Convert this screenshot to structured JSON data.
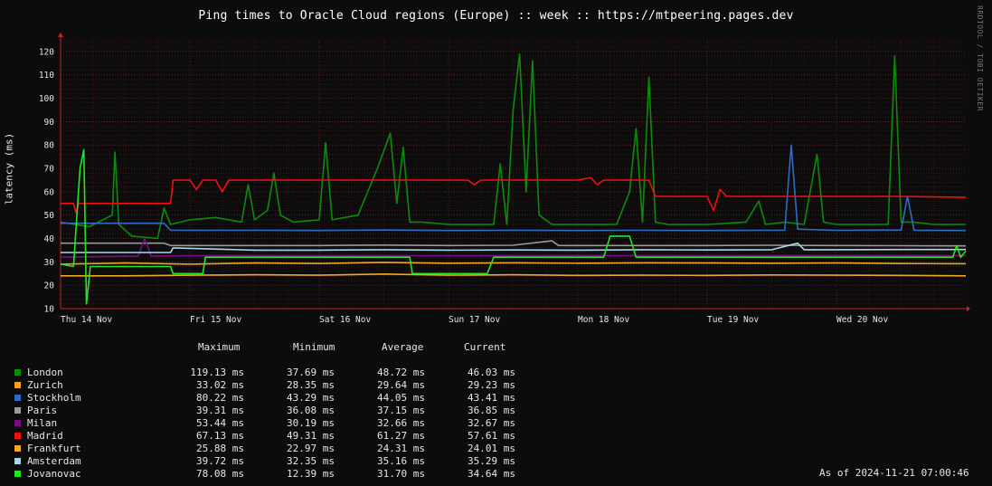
{
  "title": "Ping times to Oracle Cloud regions (Europe) :: week :: https://mtpeering.pages.dev",
  "watermark": "RRDTOOL / TOBI OETIKER",
  "legend_headers": {
    "maximum": "Maximum",
    "minimum": "Minimum",
    "average": "Average",
    "current": "Current"
  },
  "legend_rows": [
    {
      "name": "London",
      "color": "#0b8c0b",
      "max": "119.13 ms",
      "min": "37.69 ms",
      "avg": "48.72 ms",
      "cur": "46.03 ms"
    },
    {
      "name": "Zurich",
      "color": "#f0a21c",
      "max": "33.02 ms",
      "min": "28.35 ms",
      "avg": "29.64 ms",
      "cur": "29.23 ms"
    },
    {
      "name": "Stockholm",
      "color": "#2f6cc2",
      "max": "80.22 ms",
      "min": "43.29 ms",
      "avg": "44.05 ms",
      "cur": "43.41 ms"
    },
    {
      "name": "Paris",
      "color": "#9a9a9a",
      "max": "39.31 ms",
      "min": "36.08 ms",
      "avg": "37.15 ms",
      "cur": "36.85 ms"
    },
    {
      "name": "Milan",
      "color": "#7a0d86",
      "max": "53.44 ms",
      "min": "30.19 ms",
      "avg": "32.66 ms",
      "cur": "32.67 ms"
    },
    {
      "name": "Madrid",
      "color": "#f01010",
      "max": "67.13 ms",
      "min": "49.31 ms",
      "avg": "61.27 ms",
      "cur": "57.61 ms"
    },
    {
      "name": "Frankfurt",
      "color": "#f5a623",
      "max": "25.88 ms",
      "min": "22.97 ms",
      "avg": "24.31 ms",
      "cur": "24.01 ms"
    },
    {
      "name": "Amsterdam",
      "color": "#a9d8ea",
      "max": "39.72 ms",
      "min": "32.35 ms",
      "avg": "35.16 ms",
      "cur": "35.29 ms"
    },
    {
      "name": "Jovanovac",
      "color": "#22e622",
      "max": "78.08 ms",
      "min": "12.39 ms",
      "avg": "31.70 ms",
      "cur": "34.64 ms"
    }
  ],
  "as_of": "As of 2024-11-21 07:00:46",
  "chart_data": {
    "type": "line",
    "title": "Ping times to Oracle Cloud regions (Europe) :: week :: https://mtpeering.pages.dev",
    "ylabel": "latency (ms)",
    "xlabel": "",
    "ylim": [
      10,
      125
    ],
    "yticks": [
      10,
      20,
      30,
      40,
      50,
      60,
      70,
      80,
      90,
      100,
      110,
      120
    ],
    "xlim": [
      0,
      7
    ],
    "xtick_labels": [
      "Thu 14 Nov",
      "Fri 15 Nov",
      "Sat 16 Nov",
      "Sun 17 Nov",
      "Mon 18 Nov",
      "Tue 19 Nov",
      "Wed 20 Nov"
    ],
    "grid": true,
    "series": [
      {
        "name": "London",
        "color": "#0b8c0b",
        "points": [
          [
            0,
            47
          ],
          [
            0.22,
            45
          ],
          [
            0.4,
            50
          ],
          [
            0.42,
            77
          ],
          [
            0.45,
            46
          ],
          [
            0.55,
            41
          ],
          [
            0.75,
            40
          ],
          [
            0.8,
            53
          ],
          [
            0.85,
            46
          ],
          [
            1.0,
            48
          ],
          [
            1.2,
            49
          ],
          [
            1.4,
            47
          ],
          [
            1.45,
            63
          ],
          [
            1.5,
            48
          ],
          [
            1.6,
            52
          ],
          [
            1.65,
            68
          ],
          [
            1.7,
            50
          ],
          [
            1.8,
            47
          ],
          [
            2.0,
            48
          ],
          [
            2.05,
            81
          ],
          [
            2.1,
            48
          ],
          [
            2.3,
            50
          ],
          [
            2.45,
            70
          ],
          [
            2.55,
            85
          ],
          [
            2.6,
            55
          ],
          [
            2.65,
            79
          ],
          [
            2.7,
            47
          ],
          [
            2.8,
            47
          ],
          [
            3.0,
            46
          ],
          [
            3.35,
            46
          ],
          [
            3.4,
            72
          ],
          [
            3.45,
            46
          ],
          [
            3.5,
            95
          ],
          [
            3.55,
            119
          ],
          [
            3.6,
            60
          ],
          [
            3.65,
            116
          ],
          [
            3.7,
            50
          ],
          [
            3.8,
            46
          ],
          [
            4.0,
            46
          ],
          [
            4.3,
            46
          ],
          [
            4.4,
            60
          ],
          [
            4.45,
            87
          ],
          [
            4.5,
            47
          ],
          [
            4.55,
            109
          ],
          [
            4.6,
            47
          ],
          [
            4.7,
            46
          ],
          [
            5.0,
            46
          ],
          [
            5.3,
            47
          ],
          [
            5.4,
            56
          ],
          [
            5.45,
            46
          ],
          [
            5.6,
            47
          ],
          [
            5.75,
            46
          ],
          [
            5.85,
            76
          ],
          [
            5.9,
            47
          ],
          [
            6.0,
            46
          ],
          [
            6.4,
            46
          ],
          [
            6.45,
            118
          ],
          [
            6.5,
            47
          ],
          [
            6.6,
            47
          ],
          [
            6.75,
            46
          ],
          [
            7.0,
            46
          ]
        ]
      },
      {
        "name": "Zurich",
        "color": "#f0a21c",
        "points": [
          [
            0,
            29
          ],
          [
            0.5,
            29.5
          ],
          [
            1.0,
            29
          ],
          [
            1.5,
            29.5
          ],
          [
            2.0,
            29.3
          ],
          [
            2.5,
            29.8
          ],
          [
            3.0,
            29.4
          ],
          [
            3.5,
            29.6
          ],
          [
            4.0,
            29.4
          ],
          [
            4.5,
            29.6
          ],
          [
            5.0,
            29.5
          ],
          [
            5.5,
            29.4
          ],
          [
            6.0,
            29.5
          ],
          [
            6.5,
            29.3
          ],
          [
            7.0,
            29.2
          ]
        ]
      },
      {
        "name": "Stockholm",
        "color": "#2f6cc2",
        "points": [
          [
            0,
            46.5
          ],
          [
            0.8,
            46.5
          ],
          [
            0.85,
            43.5
          ],
          [
            1.5,
            43.5
          ],
          [
            2.0,
            43.4
          ],
          [
            2.5,
            43.6
          ],
          [
            3.0,
            43.4
          ],
          [
            3.5,
            43.5
          ],
          [
            4.0,
            43.4
          ],
          [
            4.5,
            43.5
          ],
          [
            5.0,
            43.4
          ],
          [
            5.5,
            43.5
          ],
          [
            5.6,
            43.5
          ],
          [
            5.65,
            80
          ],
          [
            5.7,
            44
          ],
          [
            6.0,
            43.5
          ],
          [
            6.5,
            43.6
          ],
          [
            6.55,
            58
          ],
          [
            6.6,
            43.5
          ],
          [
            7.0,
            43.4
          ]
        ]
      },
      {
        "name": "Paris",
        "color": "#9a9a9a",
        "points": [
          [
            0,
            38
          ],
          [
            0.8,
            38
          ],
          [
            0.85,
            37
          ],
          [
            1.5,
            37
          ],
          [
            2.0,
            37
          ],
          [
            2.5,
            37.2
          ],
          [
            3.0,
            37
          ],
          [
            3.5,
            37.1
          ],
          [
            3.8,
            39
          ],
          [
            3.85,
            37
          ],
          [
            4.5,
            37
          ],
          [
            5.0,
            37
          ],
          [
            5.5,
            37.1
          ],
          [
            6.0,
            37
          ],
          [
            6.5,
            36.9
          ],
          [
            7.0,
            36.85
          ]
        ]
      },
      {
        "name": "Milan",
        "color": "#7a0d86",
        "points": [
          [
            0,
            32
          ],
          [
            0.6,
            32.5
          ],
          [
            0.65,
            40
          ],
          [
            0.7,
            32.5
          ],
          [
            1.0,
            32.6
          ],
          [
            1.5,
            32.7
          ],
          [
            2.0,
            32.6
          ],
          [
            3.0,
            32.6
          ],
          [
            4.0,
            32.7
          ],
          [
            5.0,
            32.6
          ],
          [
            6.0,
            32.7
          ],
          [
            7.0,
            32.67
          ]
        ]
      },
      {
        "name": "Madrid",
        "color": "#f01010",
        "points": [
          [
            0,
            55
          ],
          [
            0.1,
            55
          ],
          [
            0.12,
            51
          ],
          [
            0.14,
            55
          ],
          [
            0.85,
            55
          ],
          [
            0.87,
            65
          ],
          [
            1.0,
            65
          ],
          [
            1.05,
            61
          ],
          [
            1.1,
            65
          ],
          [
            1.2,
            65
          ],
          [
            1.25,
            60
          ],
          [
            1.3,
            65
          ],
          [
            2.0,
            65
          ],
          [
            3.0,
            65
          ],
          [
            3.15,
            65
          ],
          [
            3.2,
            63
          ],
          [
            3.25,
            65
          ],
          [
            4.0,
            65
          ],
          [
            4.1,
            66
          ],
          [
            4.15,
            63
          ],
          [
            4.2,
            65
          ],
          [
            4.45,
            65
          ],
          [
            4.55,
            65
          ],
          [
            4.6,
            58
          ],
          [
            5.0,
            58
          ],
          [
            5.05,
            52
          ],
          [
            5.1,
            61
          ],
          [
            5.15,
            58
          ],
          [
            5.5,
            58
          ],
          [
            6.0,
            58
          ],
          [
            6.5,
            58
          ],
          [
            7.0,
            57.6
          ]
        ]
      },
      {
        "name": "Frankfurt",
        "color": "#f5a623",
        "points": [
          [
            0,
            24
          ],
          [
            0.5,
            24
          ],
          [
            1.0,
            24.3
          ],
          [
            1.5,
            24.5
          ],
          [
            2.0,
            24.3
          ],
          [
            2.5,
            24.8
          ],
          [
            3.0,
            24.3
          ],
          [
            3.5,
            24.5
          ],
          [
            4.0,
            24.2
          ],
          [
            4.5,
            24.3
          ],
          [
            5.0,
            24.2
          ],
          [
            5.5,
            24.4
          ],
          [
            6.0,
            24.3
          ],
          [
            6.5,
            24.2
          ],
          [
            7.0,
            24.0
          ]
        ]
      },
      {
        "name": "Amsterdam",
        "color": "#a9d8ea",
        "points": [
          [
            0,
            34
          ],
          [
            0.85,
            34
          ],
          [
            0.87,
            36
          ],
          [
            1.5,
            35
          ],
          [
            2.0,
            35
          ],
          [
            2.5,
            35.2
          ],
          [
            3.0,
            35
          ],
          [
            3.5,
            35.1
          ],
          [
            4.0,
            35
          ],
          [
            4.5,
            35.2
          ],
          [
            5.0,
            35.1
          ],
          [
            5.5,
            35.2
          ],
          [
            5.7,
            38
          ],
          [
            5.75,
            35.2
          ],
          [
            6.0,
            35.2
          ],
          [
            6.5,
            35.3
          ],
          [
            7.0,
            35.29
          ]
        ]
      },
      {
        "name": "Jovanovac",
        "color": "#22e622",
        "points": [
          [
            0,
            29
          ],
          [
            0.1,
            28
          ],
          [
            0.15,
            70
          ],
          [
            0.18,
            78
          ],
          [
            0.2,
            12
          ],
          [
            0.23,
            28
          ],
          [
            0.85,
            28
          ],
          [
            0.87,
            25
          ],
          [
            1.1,
            25
          ],
          [
            1.12,
            32
          ],
          [
            2.0,
            32
          ],
          [
            2.5,
            32
          ],
          [
            2.7,
            32
          ],
          [
            2.72,
            25
          ],
          [
            3.3,
            25
          ],
          [
            3.35,
            32
          ],
          [
            4.0,
            32
          ],
          [
            4.2,
            32
          ],
          [
            4.25,
            41
          ],
          [
            4.4,
            41
          ],
          [
            4.45,
            32
          ],
          [
            5.0,
            32
          ],
          [
            5.5,
            32
          ],
          [
            6.0,
            32
          ],
          [
            6.5,
            32
          ],
          [
            6.9,
            32
          ],
          [
            6.93,
            37
          ],
          [
            6.96,
            32
          ],
          [
            7.0,
            34.6
          ]
        ]
      }
    ]
  }
}
